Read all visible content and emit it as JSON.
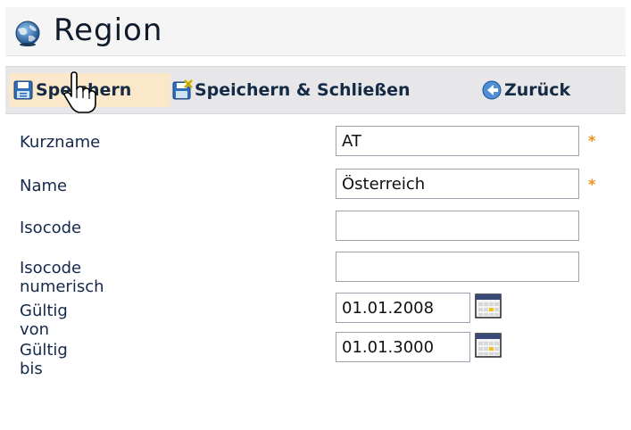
{
  "window": {
    "title": "Region"
  },
  "toolbar": {
    "save_label": "Speichern",
    "save_close_label": "Speichern & Schließen",
    "back_label": "Zurück"
  },
  "form": {
    "required_marker": "*",
    "fields": [
      {
        "label": "Kurzname",
        "value": "AT",
        "required": true
      },
      {
        "label": "Name",
        "value": "Österreich",
        "required": true
      },
      {
        "label": "Isocode",
        "value": "",
        "required": false
      },
      {
        "label": "Isocode numerisch",
        "value": "",
        "required": false
      },
      {
        "label": "Gültig von",
        "value": "01.01.2008",
        "required": false
      },
      {
        "label": "Gültig bis",
        "value": "01.01.3000",
        "required": false
      }
    ]
  },
  "colors": {
    "accent_orange": "#f08c1a",
    "toolbar_bg": "#e7e7e9",
    "hover_bg": "#fbe7c9",
    "label_text": "#15284a"
  },
  "icons": {
    "title": "globe-icon",
    "save": "floppy-disk-icon",
    "save_close": "floppy-disk-close-icon",
    "back": "arrow-left-circle-icon",
    "calendar": "calendar-icon",
    "cursor": "hand-pointer-cursor"
  }
}
